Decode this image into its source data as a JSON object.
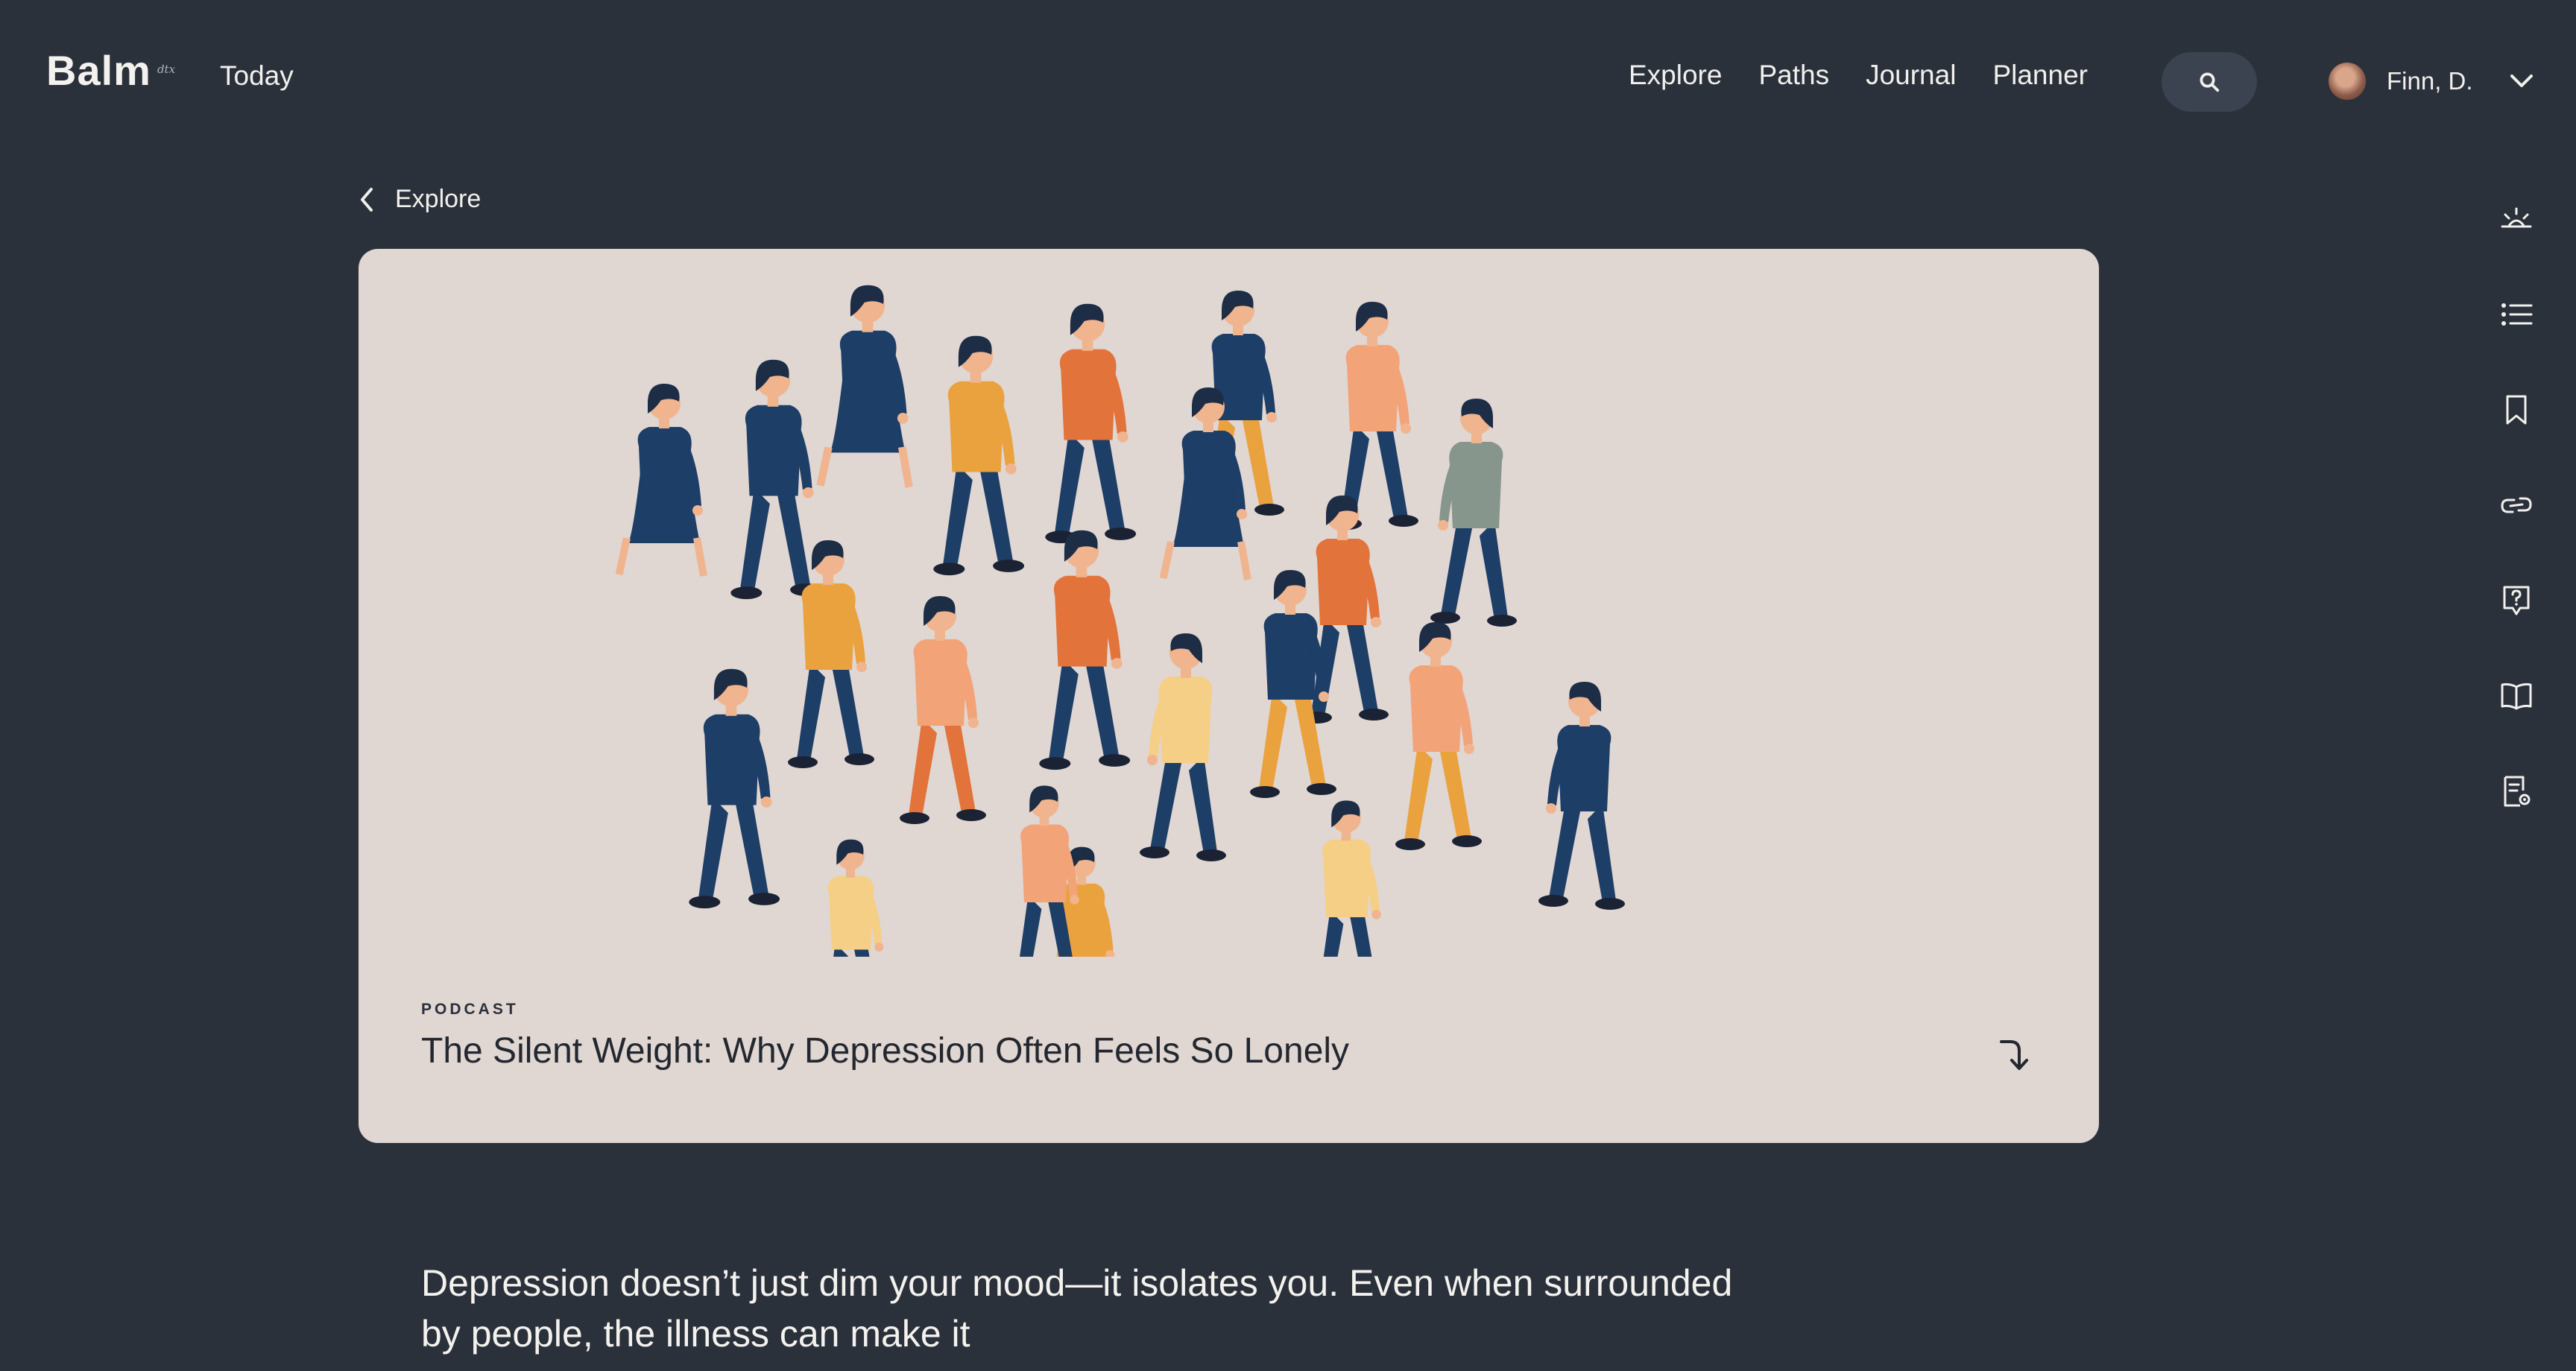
{
  "header": {
    "logo": "Balm",
    "logo_sup": "dtx",
    "today": "Today",
    "nav": [
      "Explore",
      "Paths",
      "Journal",
      "Planner"
    ],
    "search_icon": "search-icon",
    "user_name": "Finn, D.",
    "user_menu_icon": "chevron-down-icon"
  },
  "breadcrumb": {
    "label": "Explore",
    "icon": "chevron-left-icon"
  },
  "card": {
    "eyebrow": "PODCAST",
    "title": "The Silent Weight: Why Depression Often Feels So Lonely",
    "action_icon": "curved-arrow-icon",
    "illustration": "crowd-of-people-walking"
  },
  "rail": {
    "icons": [
      "sunrise-icon",
      "list-icon",
      "bookmark-icon",
      "link-icon",
      "help-icon",
      "book-icon",
      "document-settings-icon"
    ]
  },
  "article": {
    "lead": "Depression doesn’t just dim your mood—it isolates you. Even when surrounded by people, the illness can make it"
  },
  "colors": {
    "background": "#2b313b",
    "card": "#e0d6d2",
    "navy": "#1d3e66",
    "orange": "#e2733a",
    "amber": "#eaa23f",
    "peach": "#f2a377",
    "butter": "#f5cf86",
    "sage": "#87968c"
  }
}
